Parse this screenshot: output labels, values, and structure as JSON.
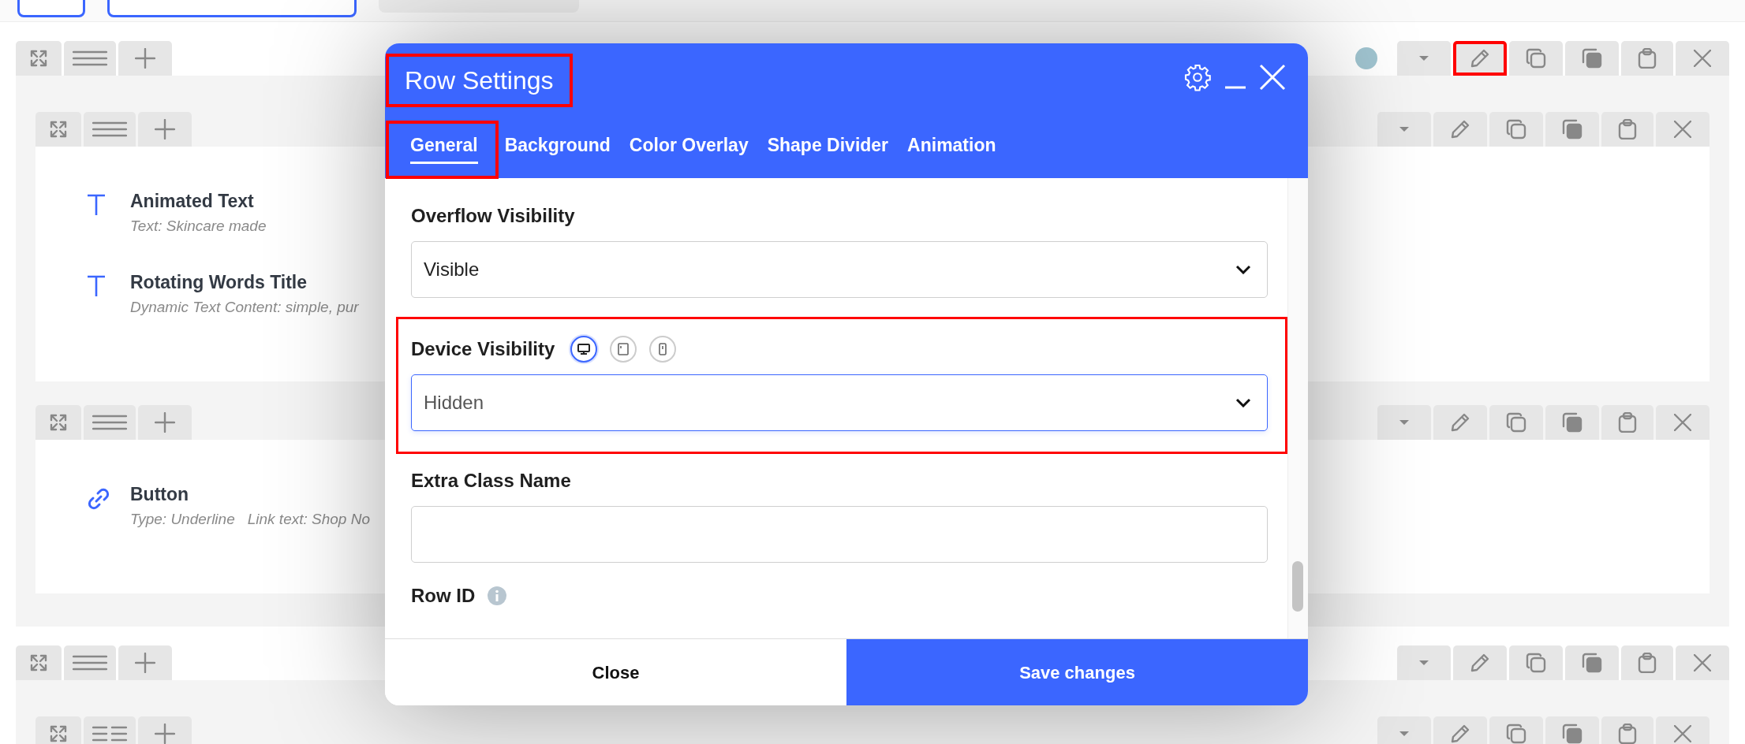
{
  "rows": [
    {
      "color": "#a0c4d0",
      "edit_highlighted": true,
      "sections": [
        {
          "kind": "single",
          "elements": [
            {
              "kind": "text",
              "title": "Animated Text",
              "details": [
                "Text: Skincare made"
              ]
            },
            {
              "kind": "text",
              "title": "Rotating Words Title",
              "details": [
                "Dynamic Text Content: simple, pur"
              ]
            }
          ]
        },
        {
          "kind": "single",
          "elements": [
            {
              "kind": "link",
              "title": "Button",
              "details": [
                "Type: Underline",
                "Link text: Shop No"
              ]
            }
          ]
        }
      ]
    },
    {
      "sections": [
        {
          "kind": "columns"
        }
      ]
    }
  ],
  "dialog": {
    "title": "Row Settings",
    "title_highlighted": true,
    "tabs": [
      {
        "label": "General",
        "selected": true,
        "highlighted": true
      },
      {
        "label": "Background",
        "selected": false,
        "highlighted": false
      },
      {
        "label": "Color Overlay",
        "selected": false,
        "highlighted": false
      },
      {
        "label": "Shape Divider",
        "selected": false,
        "highlighted": false
      },
      {
        "label": "Animation",
        "selected": false,
        "highlighted": false
      }
    ],
    "fields": [
      {
        "kind": "select",
        "label": "Overflow Visibility",
        "value": "Visible",
        "focused": false,
        "highlighted": false
      },
      {
        "kind": "select",
        "label": "Device Visibility",
        "value": "Hidden",
        "focused": true,
        "highlighted": true,
        "devices": [
          {
            "kind": "desktop",
            "selected": true
          },
          {
            "kind": "tablet",
            "selected": false
          },
          {
            "kind": "mobile",
            "selected": false
          }
        ]
      },
      {
        "kind": "text",
        "label": "Extra Class Name",
        "highlighted": false
      },
      {
        "kind": "heading",
        "label": "Row ID",
        "info": true,
        "highlighted": false
      }
    ],
    "buttons": [
      {
        "label": "Close",
        "primary": false
      },
      {
        "label": "Save changes",
        "primary": true
      }
    ]
  }
}
